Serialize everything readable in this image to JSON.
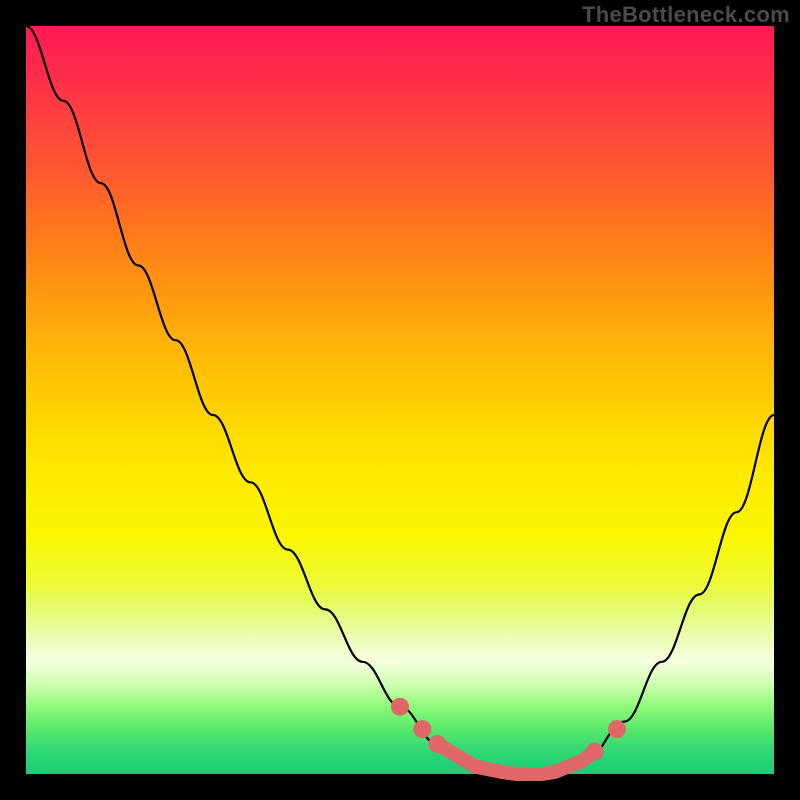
{
  "watermark": "TheBottleneck.com",
  "colors": {
    "background": "#000000",
    "curve": "#000000",
    "highlight": "#e06767",
    "gradient_top": "#ff1a55",
    "gradient_bottom": "#1acb78"
  },
  "chart_data": {
    "type": "line",
    "title": "",
    "xlabel": "",
    "ylabel": "",
    "xlim": [
      0,
      100
    ],
    "ylim": [
      0,
      100
    ],
    "x": [
      0,
      5,
      10,
      15,
      20,
      25,
      30,
      35,
      40,
      45,
      50,
      55,
      60,
      65,
      70,
      75,
      80,
      85,
      90,
      95,
      100
    ],
    "series": [
      {
        "name": "bottleneck_pct",
        "values": [
          100,
          90,
          79,
          68,
          58,
          48,
          39,
          30,
          22,
          15,
          9,
          4,
          1,
          0,
          0,
          2,
          7,
          15,
          24,
          35,
          48
        ]
      }
    ],
    "optimal_range_x": [
      55,
      76
    ],
    "optimal_markers_x": [
      50,
      53,
      55,
      76,
      79
    ],
    "grid": false,
    "legend": false
  }
}
